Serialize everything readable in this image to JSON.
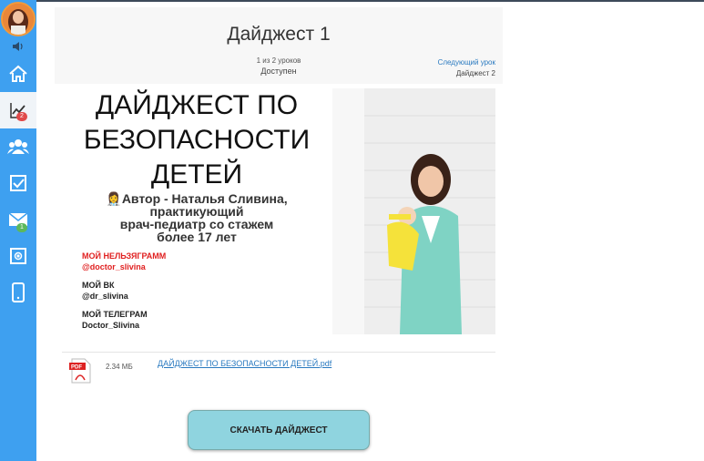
{
  "lesson": {
    "title": "Дайджест 1",
    "count": "1 из 2 уроков",
    "status": "Доступен",
    "next_link": "Следующий урок",
    "next_title": "Дайджест 2"
  },
  "sidebar": {
    "badges": {
      "stats": "2",
      "messages": "1"
    },
    "icons": [
      "home-icon",
      "chart-icon",
      "users-icon",
      "checkbox-icon",
      "mail-icon",
      "store-icon",
      "phone-icon"
    ]
  },
  "banner": {
    "headline_lines": [
      "ДАЙДЖЕСТ ПО",
      "БЕЗОПАСНОСТИ",
      "ДЕТЕЙ"
    ],
    "author_lines": [
      "Автор - Наталья Сливина,",
      "практикующий",
      "врач-педиатр со стажем",
      "более 17 лет"
    ],
    "contacts": [
      {
        "label": "МОЙ НЕЛЬЗЯГРАММ",
        "value": "@doctor_slivina",
        "color": "#e02020"
      },
      {
        "label": "МОЙ ВК",
        "value": "@dr_slivina",
        "color": "#111111"
      },
      {
        "label": "МОЙ ТЕЛЕГРАМ",
        "value": "Doctor_Slivina",
        "color": "#111111"
      }
    ]
  },
  "file": {
    "size": "2.34 МБ",
    "name": "ДАЙДЖЕСТ ПО БЕЗОПАСНОСТИ ДЕТЕЙ.pdf"
  },
  "download_button": "СКАЧАТЬ ДАЙДЖЕСТ",
  "colors": {
    "sidebar": "#3ea0f0",
    "button": "#8fd4df",
    "link": "#2a7ac0",
    "accent_red": "#e02020"
  }
}
